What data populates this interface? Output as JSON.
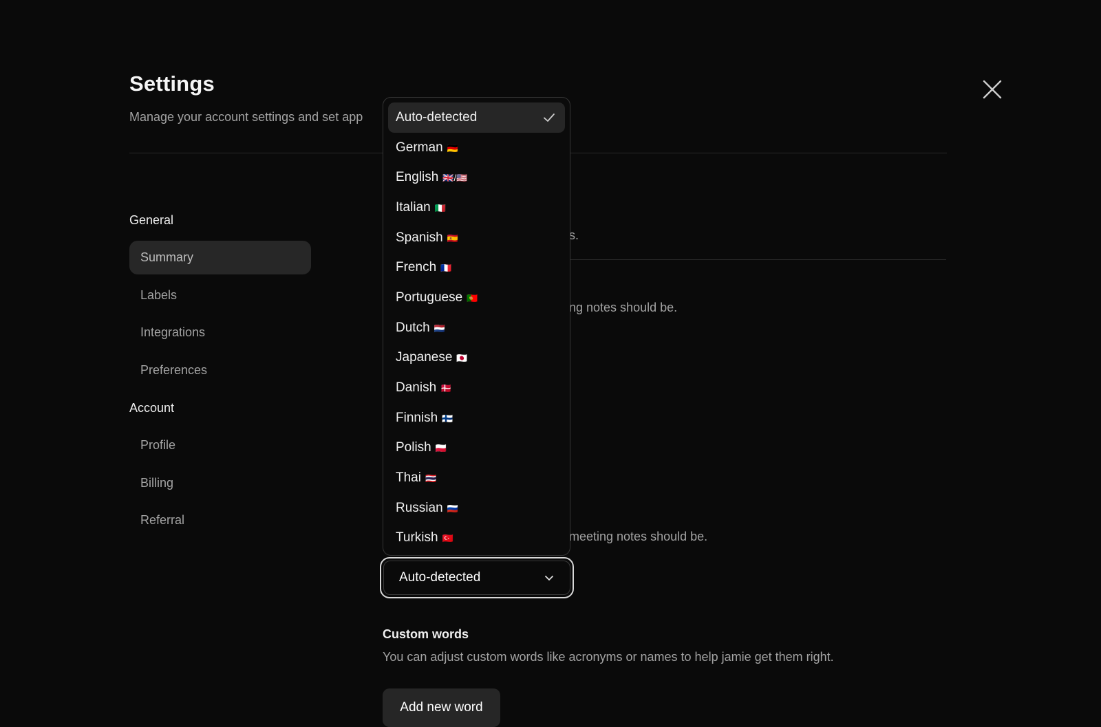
{
  "header": {
    "title": "Settings",
    "subtitle": "Manage your account settings and set app"
  },
  "sidebar": {
    "sections": [
      {
        "label": "General",
        "items": [
          "Summary",
          "Labels",
          "Integrations",
          "Preferences"
        ]
      },
      {
        "label": "Account",
        "items": [
          "Profile",
          "Billing",
          "Referral"
        ]
      }
    ],
    "active_item": "Summary"
  },
  "fragments": {
    "top_line": "s.",
    "mid_line": "ng notes should be.",
    "lower_line": "meeting notes should be."
  },
  "language_select": {
    "value": "Auto-detected",
    "options": [
      {
        "label": "Auto-detected",
        "flag": "",
        "selected": true
      },
      {
        "label": "German",
        "flag": "🇩🇪"
      },
      {
        "label": "English",
        "flag": "🇬🇧/🇺🇸"
      },
      {
        "label": "Italian",
        "flag": "🇮🇹"
      },
      {
        "label": "Spanish",
        "flag": "🇪🇸"
      },
      {
        "label": "French",
        "flag": "🇫🇷"
      },
      {
        "label": "Portuguese",
        "flag": "🇵🇹"
      },
      {
        "label": "Dutch",
        "flag": "🇳🇱"
      },
      {
        "label": "Japanese",
        "flag": "🇯🇵"
      },
      {
        "label": "Danish",
        "flag": "🇩🇰"
      },
      {
        "label": "Finnish",
        "flag": "🇫🇮"
      },
      {
        "label": "Polish",
        "flag": "🇵🇱"
      },
      {
        "label": "Thai",
        "flag": "🇹🇭"
      },
      {
        "label": "Russian",
        "flag": "🇷🇺"
      },
      {
        "label": "Turkish",
        "flag": "🇹🇷"
      }
    ]
  },
  "custom_words": {
    "title": "Custom words",
    "description": "You can adjust custom words like acronyms or names to help jamie get them right.",
    "button_label": "Add new word"
  },
  "icons": {
    "close": "close-icon",
    "chevron": "chevron-down-icon",
    "check": "check-icon"
  }
}
